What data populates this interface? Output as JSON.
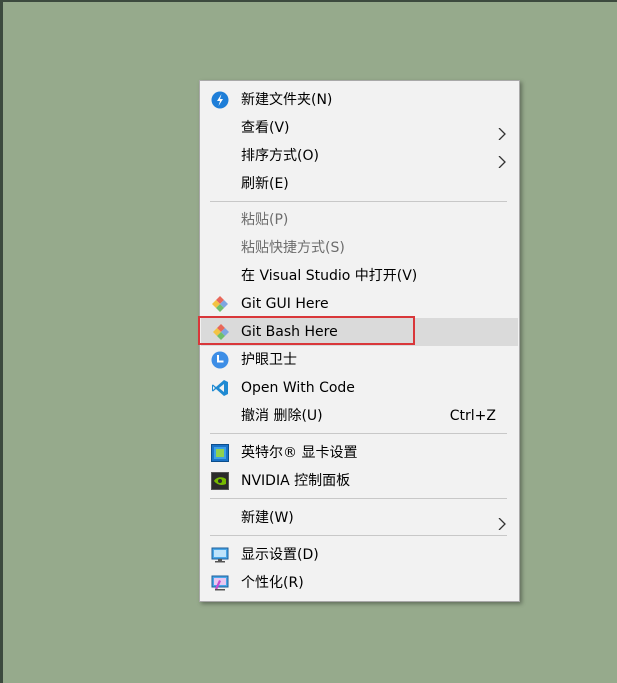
{
  "context_menu": {
    "items": [
      {
        "label": "新建文件夹(N)",
        "icon": "new-folder-icon"
      },
      {
        "label": "查看(V)",
        "submenu": true
      },
      {
        "label": "排序方式(O)",
        "submenu": true
      },
      {
        "label": "刷新(E)"
      },
      {
        "label": "粘贴(P)",
        "disabled": true
      },
      {
        "label": "粘贴快捷方式(S)",
        "disabled": true
      },
      {
        "label": "在 Visual Studio 中打开(V)"
      },
      {
        "label": "Git GUI Here",
        "icon": "git-icon"
      },
      {
        "label": "Git Bash Here",
        "icon": "git-icon",
        "hovered": true
      },
      {
        "label": "护眼卫士",
        "icon": "eye-care-icon"
      },
      {
        "label": "Open With Code",
        "icon": "vscode-icon"
      },
      {
        "label": "撤消 删除(U)",
        "shortcut": "Ctrl+Z"
      },
      {
        "label": "英特尔® 显卡设置",
        "icon": "intel-graphics-icon"
      },
      {
        "label": "NVIDIA 控制面板",
        "icon": "nvidia-icon"
      },
      {
        "label": "新建(W)",
        "submenu": true
      },
      {
        "label": "显示设置(D)",
        "icon": "display-icon"
      },
      {
        "label": "个性化(R)",
        "icon": "personalize-icon"
      }
    ]
  },
  "colors": {
    "desktop": "#96aa8c",
    "menu_bg": "#f2f2f2",
    "hover_bg": "#dadada",
    "highlight_border": "#d9373a",
    "disabled_text": "#6d6d6d"
  }
}
